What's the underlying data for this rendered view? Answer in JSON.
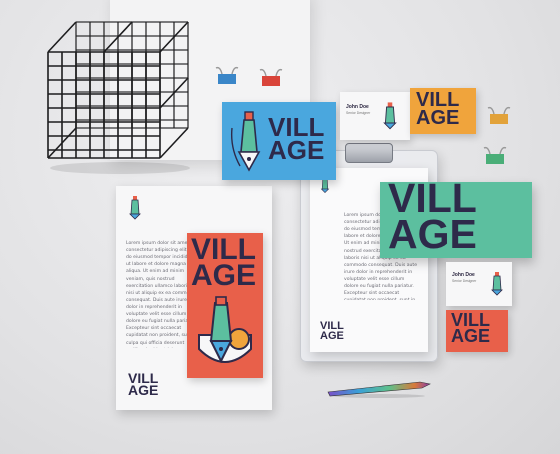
{
  "brand": {
    "wordmark_line1": "VILL",
    "wordmark_line2": "AGE"
  },
  "card": {
    "name": "John Doe",
    "role": "Senior Designer"
  },
  "letter_text": "Lorem ipsum dolor sit amet, consectetur adipiscing elit, sed do eiusmod tempor incididunt ut labore et dolore magna aliqua. Ut enim ad minim veniam, quis nostrud exercitation ullamco laboris nisi ut aliquip ex ea commodo consequat. Duis aute irure dolor in reprehenderit in voluptate velit esse cillum dolore eu fugiat nulla pariatur. Excepteur sint occaecat cupidatat non proident, sunt in culpa qui officia deserunt mollit anim id est laborum.",
  "colors": {
    "navy": "#2e2a4a",
    "blue": "#4aa7de",
    "mint": "#5cbf9f",
    "coral": "#e8604a",
    "orange": "#f0a43c",
    "background": "#e4e4e6"
  }
}
